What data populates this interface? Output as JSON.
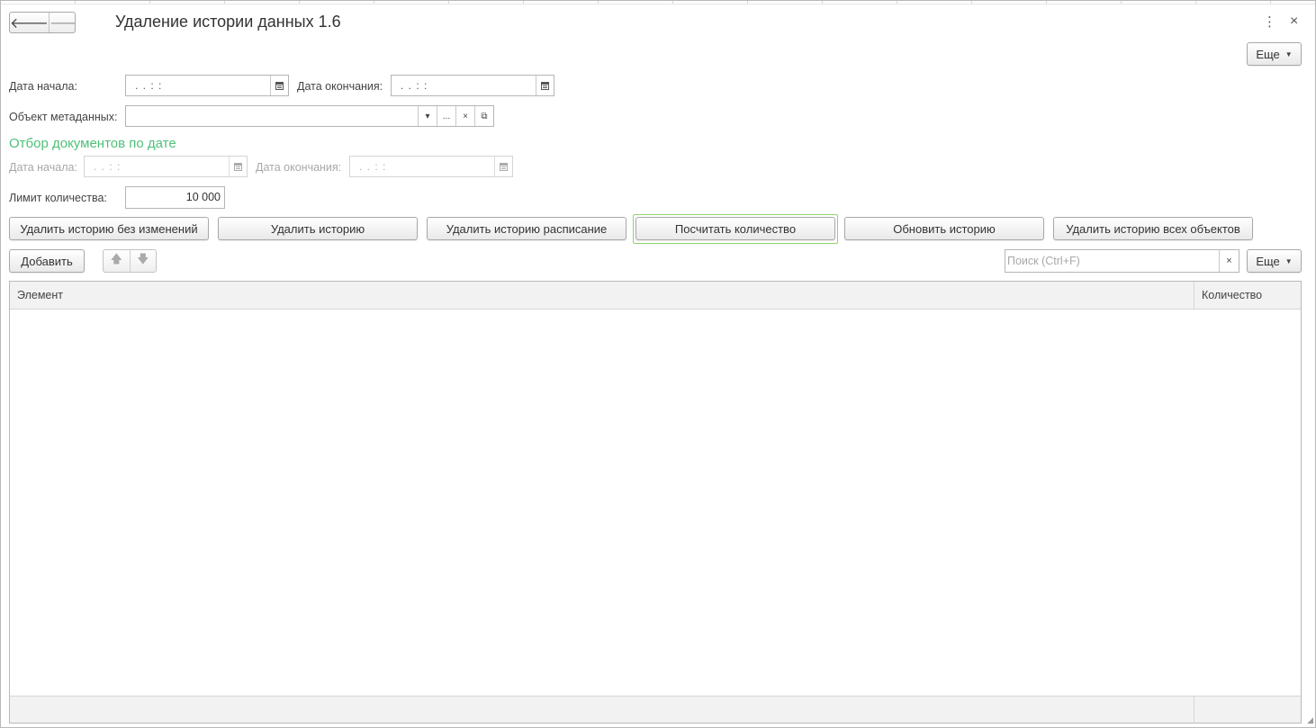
{
  "window": {
    "title": "Удаление истории данных 1.6",
    "nav_back_icon": "arrow-left-icon",
    "nav_forward_icon": "arrow-right-icon",
    "more_icon": "⋮",
    "close_icon": "×"
  },
  "top_more_button": {
    "label": "Еще"
  },
  "period": {
    "start_label": "Дата начала:",
    "start_value": ".  .       :  :",
    "end_label": "Дата окончания:",
    "end_value": ".  .       :  :"
  },
  "metadata": {
    "label": "Объект метаданных:",
    "value": "",
    "dropdown_glyph": "▾",
    "select_glyph": "...",
    "clear_glyph": "×",
    "open_glyph": "⧉"
  },
  "doc_filter": {
    "title": "Отбор документов по дате",
    "start_label": "Дата начала:",
    "start_value": ".  .       :  :",
    "end_label": "Дата окончания:",
    "end_value": ".  .       :  :"
  },
  "limit": {
    "label": "Лимит количества:",
    "value": "10 000"
  },
  "actions": {
    "delete_no_changes": "Удалить историю без изменений",
    "delete_history": "Удалить историю",
    "delete_schedule": "Удалить историю расписание",
    "count": "Посчитать количество",
    "update_history": "Обновить историю",
    "delete_all_objects": "Удалить историю всех объектов"
  },
  "table_toolbar": {
    "add_label": "Добавить",
    "move_up_glyph": "🡅",
    "move_down_glyph": "🡇",
    "search_placeholder": "Поиск (Ctrl+F)",
    "search_clear_glyph": "×",
    "more_label": "Еще"
  },
  "table": {
    "columns": [
      "Элемент",
      "Количество"
    ],
    "rows": []
  },
  "colors": {
    "section_title": "#4fc07a",
    "focus_ring": "#8fd46b"
  }
}
